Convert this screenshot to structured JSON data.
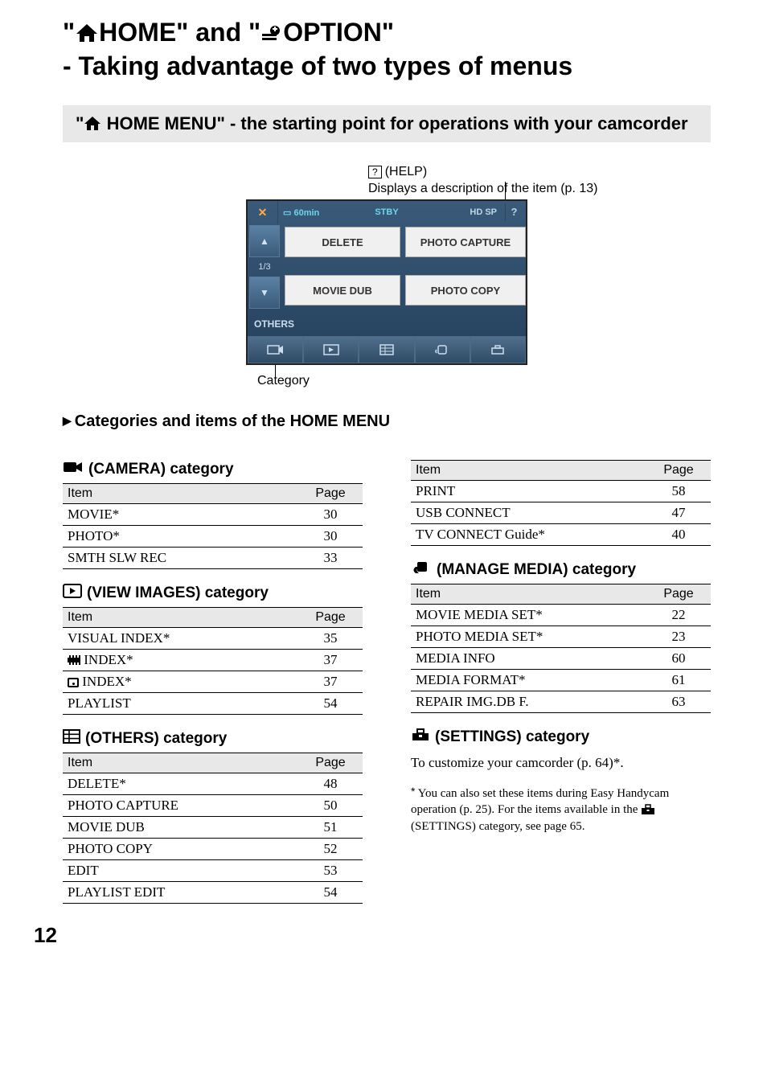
{
  "title": {
    "part1": "\"",
    "part2": "HOME\" and \"",
    "part3": "OPTION\"",
    "line2": "- Taking advantage of two types of menus"
  },
  "section_header": {
    "prefix": "\"",
    "label": "HOME MENU\" - the starting point for operations with your camcorder"
  },
  "diagram": {
    "help_symbol": "?",
    "help_label": "(HELP)",
    "help_desc": "Displays a description of the item (p. 13)",
    "screen": {
      "close": "✕",
      "battery": "60min",
      "stby": "STBY",
      "hd": "HD SP",
      "help_q": "?",
      "page": "1/3",
      "btn1": "DELETE",
      "btn2": "PHOTO CAPTURE",
      "btn3": "MOVIE DUB",
      "btn4": "PHOTO COPY",
      "others": "OTHERS"
    },
    "category_label": "Category"
  },
  "subhead": "Categories and items of the HOME MENU",
  "th_item": "Item",
  "th_page": "Page",
  "categories": {
    "camera": {
      "title": "(CAMERA) category",
      "rows": [
        {
          "item": "MOVIE*",
          "page": "30"
        },
        {
          "item": "PHOTO*",
          "page": "30"
        },
        {
          "item": "SMTH SLW REC",
          "page": "33"
        }
      ]
    },
    "view": {
      "title": "(VIEW IMAGES) category",
      "rows": [
        {
          "item": "VISUAL INDEX*",
          "page": "35"
        },
        {
          "item": "INDEX*",
          "prefix_icon": "film",
          "page": "37"
        },
        {
          "item": "INDEX*",
          "prefix_icon": "face",
          "page": "37"
        },
        {
          "item": "PLAYLIST",
          "page": "54"
        }
      ]
    },
    "others": {
      "title": "(OTHERS) category",
      "rows": [
        {
          "item": "DELETE*",
          "page": "48"
        },
        {
          "item": "PHOTO CAPTURE",
          "page": "50"
        },
        {
          "item": "MOVIE DUB",
          "page": "51"
        },
        {
          "item": "PHOTO COPY",
          "page": "52"
        },
        {
          "item": "EDIT",
          "page": "53"
        },
        {
          "item": "PLAYLIST EDIT",
          "page": "54"
        }
      ]
    },
    "right_first": {
      "rows": [
        {
          "item": "PRINT",
          "page": "58"
        },
        {
          "item": "USB CONNECT",
          "page": "47"
        },
        {
          "item": "TV CONNECT Guide*",
          "page": "40"
        }
      ]
    },
    "manage": {
      "title": "(MANAGE MEDIA) category",
      "rows": [
        {
          "item": "MOVIE MEDIA SET*",
          "page": "22"
        },
        {
          "item": "PHOTO MEDIA SET*",
          "page": "23"
        },
        {
          "item": "MEDIA INFO",
          "page": "60"
        },
        {
          "item": "MEDIA FORMAT*",
          "page": "61"
        },
        {
          "item": "REPAIR IMG.DB F.",
          "page": "63"
        }
      ]
    },
    "settings": {
      "title": "(SETTINGS) category",
      "body": "To customize your camcorder (p. 64)*."
    }
  },
  "footnote": {
    "marker": "*",
    "text1": "You can also set these items during Easy Handycam operation (p. 25). For the items available in the ",
    "text2": " (SETTINGS) category, see page 65."
  },
  "page_number": "12",
  "chart_data": [
    {
      "type": "table",
      "title": "(CAMERA) category",
      "columns": [
        "Item",
        "Page"
      ],
      "rows": [
        [
          "MOVIE*",
          "30"
        ],
        [
          "PHOTO*",
          "30"
        ],
        [
          "SMTH SLW REC",
          "33"
        ]
      ]
    },
    {
      "type": "table",
      "title": "(VIEW IMAGES) category",
      "columns": [
        "Item",
        "Page"
      ],
      "rows": [
        [
          "VISUAL INDEX*",
          "35"
        ],
        [
          "[film] INDEX*",
          "37"
        ],
        [
          "[face] INDEX*",
          "37"
        ],
        [
          "PLAYLIST",
          "54"
        ]
      ]
    },
    {
      "type": "table",
      "title": "(OTHERS) category",
      "columns": [
        "Item",
        "Page"
      ],
      "rows": [
        [
          "DELETE*",
          "48"
        ],
        [
          "PHOTO CAPTURE",
          "50"
        ],
        [
          "MOVIE DUB",
          "51"
        ],
        [
          "PHOTO COPY",
          "52"
        ],
        [
          "EDIT",
          "53"
        ],
        [
          "PLAYLIST EDIT",
          "54"
        ]
      ]
    },
    {
      "type": "table",
      "title": "(OTHERS cont.)",
      "columns": [
        "Item",
        "Page"
      ],
      "rows": [
        [
          "PRINT",
          "58"
        ],
        [
          "USB CONNECT",
          "47"
        ],
        [
          "TV CONNECT Guide*",
          "40"
        ]
      ]
    },
    {
      "type": "table",
      "title": "(MANAGE MEDIA) category",
      "columns": [
        "Item",
        "Page"
      ],
      "rows": [
        [
          "MOVIE MEDIA SET*",
          "22"
        ],
        [
          "PHOTO MEDIA SET*",
          "23"
        ],
        [
          "MEDIA INFO",
          "60"
        ],
        [
          "MEDIA FORMAT*",
          "61"
        ],
        [
          "REPAIR IMG.DB F.",
          "63"
        ]
      ]
    }
  ]
}
